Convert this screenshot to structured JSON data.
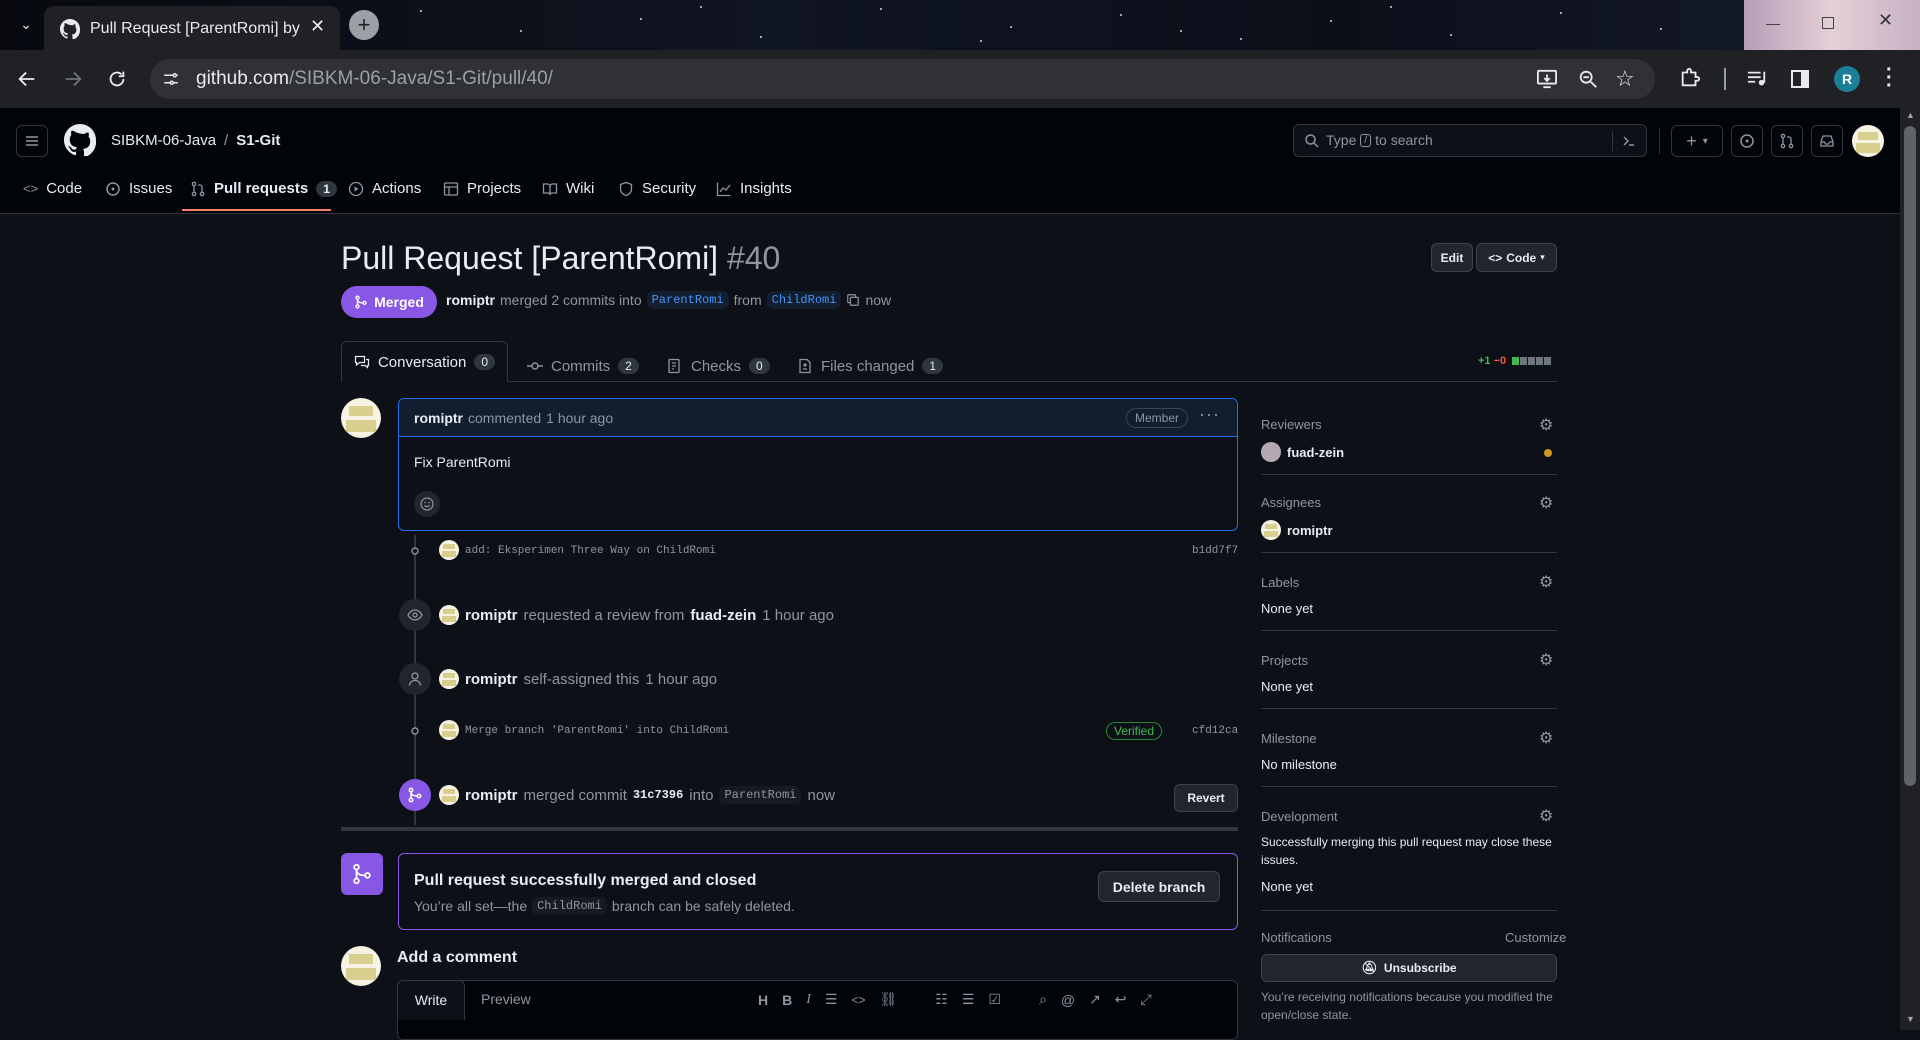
{
  "browser": {
    "tab_title": "Pull Request [ParentRomi] by ro",
    "url_domain": "github.com",
    "url_path": "/SIBKM-06-Java/S1-Git/pull/40/",
    "profile_initial": "R",
    "colors": {
      "tab_bg": "#202124",
      "profile": "#1a7f97"
    }
  },
  "repo": {
    "owner": "SIBKM-06-Java",
    "separator": "/",
    "name": "S1-Git"
  },
  "search": {
    "placeholder_pre": "Type",
    "key": "/",
    "placeholder_post": "to search"
  },
  "nav": {
    "code": "Code",
    "issues": "Issues",
    "pull_requests": "Pull requests",
    "pull_requests_count": "1",
    "actions": "Actions",
    "projects": "Projects",
    "wiki": "Wiki",
    "security": "Security",
    "insights": "Insights"
  },
  "pr": {
    "title": "Pull Request [ParentRomi]",
    "number": "#40",
    "state": "Merged",
    "author": "romiptr",
    "summary_mid": "merged 2 commits into",
    "base_branch": "ParentRomi",
    "from_word": "from",
    "head_branch": "ChildRomi",
    "time": "now",
    "edit_label": "Edit",
    "code_label": "Code"
  },
  "tabs": {
    "conversation": "Conversation",
    "conversation_count": "0",
    "commits": "Commits",
    "commits_count": "2",
    "checks": "Checks",
    "checks_count": "0",
    "files": "Files changed",
    "files_count": "1",
    "additions": "+1",
    "deletions": "−0"
  },
  "comment": {
    "author": "romiptr",
    "action": "commented",
    "time": "1 hour ago",
    "badge": "Member",
    "body": "Fix ParentRomi"
  },
  "timeline": {
    "commit1_msg": "add: Eksperimen Three Way on ChildRomi",
    "commit1_sha": "b1dd7f7",
    "review_actor": "romiptr",
    "review_text": "requested a review from",
    "review_target": "fuad-zein",
    "review_time": "1 hour ago",
    "assign_actor": "romiptr",
    "assign_text": "self-assigned this",
    "assign_time": "1 hour ago",
    "commit2_msg": "Merge branch 'ParentRomi' into ChildRomi",
    "commit2_badge": "Verified",
    "commit2_sha": "cfd12ca",
    "merge_actor": "romiptr",
    "merge_text": "merged commit",
    "merge_sha": "31c7396",
    "merge_into": "into",
    "merge_branch": "ParentRomi",
    "merge_time": "now",
    "revert_label": "Revert"
  },
  "merged_box": {
    "title": "Pull request successfully merged and closed",
    "desc_pre": "You’re all set—the",
    "branch": "ChildRomi",
    "desc_post": "branch can be safely deleted.",
    "delete_label": "Delete branch"
  },
  "add_comment": {
    "heading": "Add a comment",
    "write_tab": "Write",
    "preview_tab": "Preview"
  },
  "sidebar": {
    "reviewers_h": "Reviewers",
    "reviewer": "fuad-zein",
    "assignees_h": "Assignees",
    "assignee": "romiptr",
    "labels_h": "Labels",
    "labels_v": "None yet",
    "projects_h": "Projects",
    "projects_v": "None yet",
    "milestone_h": "Milestone",
    "milestone_v": "No milestone",
    "development_h": "Development",
    "development_desc": "Successfully merging this pull request may close these issues.",
    "development_v": "None yet",
    "notifications_h": "Notifications",
    "customize": "Customize",
    "unsubscribe": "Unsubscribe",
    "notif_reason": "You’re receiving notifications because you modified the open/close state."
  },
  "colors": {
    "merged": "#8957e5",
    "link": "#4493f8",
    "bg": "#0d1117",
    "header_bg": "#010409",
    "border": "#30363d",
    "verified": "#3fb950",
    "pending_dot": "#d29922",
    "deletion": "#f85149"
  }
}
